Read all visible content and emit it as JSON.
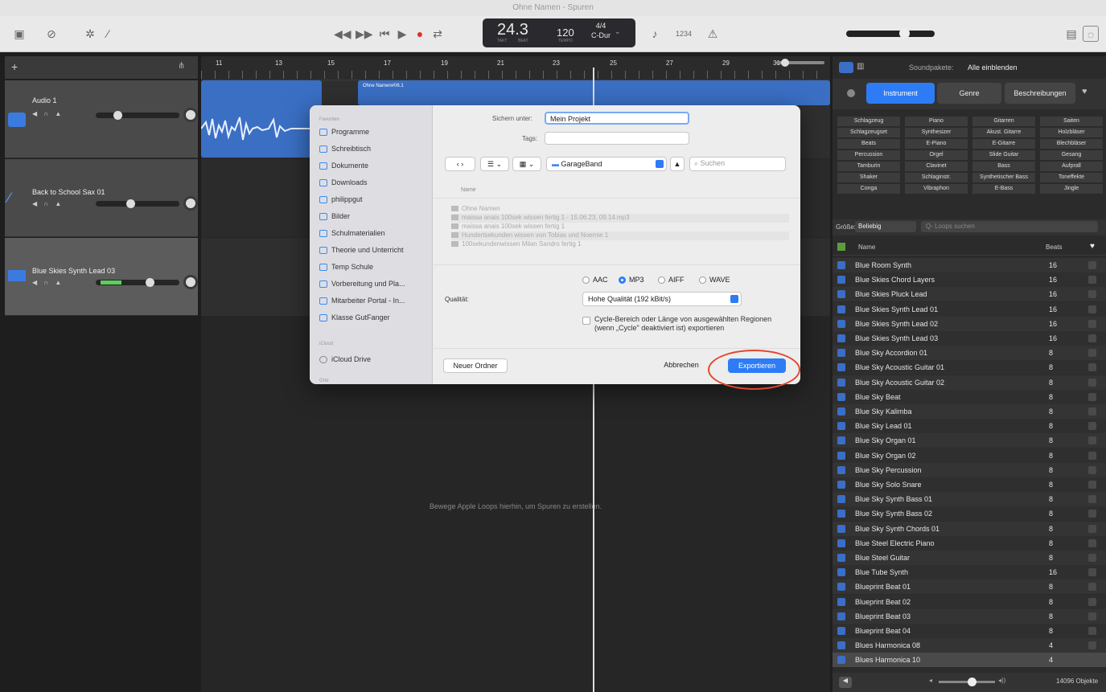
{
  "window": {
    "title": "Ohne Namen - Spuren"
  },
  "toolbar": {
    "position": "24.3",
    "position_sub1": "TAKT",
    "position_sub2": "BEAT",
    "tempo": "120",
    "tempo_sub": "TEMPO",
    "signature": "4/4",
    "key": "C-Dur",
    "count_in": "1234"
  },
  "tracks": [
    {
      "name": "Audio 1",
      "color": "#3b7be0"
    },
    {
      "name": "Back to School Sax 01",
      "color": "#3b7be0"
    },
    {
      "name": "Blue Skies Synth Lead 03",
      "color": "#3b7be0"
    }
  ],
  "ruler": {
    "ticks": [
      "11",
      "13",
      "15",
      "17",
      "19",
      "21",
      "23",
      "25",
      "27",
      "29",
      "31"
    ]
  },
  "arrange": {
    "region_label": "Ohne Namen#06.1",
    "hint": "Bewege Apple Loops hierhin, um Spuren zu erstellen."
  },
  "browser": {
    "soundpacks_label": "Soundpakete:",
    "soundpacks_value": "Alle einblenden",
    "tabs": [
      "Instrument",
      "Genre",
      "Beschreibungen"
    ],
    "chips": [
      [
        "Schlagzeug",
        "Piano",
        "Gitarren",
        "Saiten"
      ],
      [
        "Schlagzeugset",
        "Synthesizer",
        "Akust. Gitarre",
        "Holzbläser"
      ],
      [
        "Beats",
        "E-Piano",
        "E-Gitarre",
        "Blechbläser"
      ],
      [
        "Percussion",
        "Orgel",
        "Slide Guitar",
        "Gesang"
      ],
      [
        "Tamburin",
        "Clavinet",
        "Bass",
        "Aufprall"
      ],
      [
        "Shaker",
        "Schlaginstr.",
        "Synthetischer Bass",
        "Toneffekte"
      ],
      [
        "Conga",
        "Vibraphon",
        "E-Bass",
        "Jingle"
      ]
    ],
    "size_label": "Größe:",
    "size_value": "Beliebig",
    "search_placeholder": "Q- Loops suchen",
    "col_name": "Name",
    "col_beats": "Beats",
    "loops": [
      {
        "name": "Blue Room Synth",
        "beats": "16"
      },
      {
        "name": "Blue Skies Chord Layers",
        "beats": "16"
      },
      {
        "name": "Blue Skies Pluck Lead",
        "beats": "16"
      },
      {
        "name": "Blue Skies Synth Lead 01",
        "beats": "16"
      },
      {
        "name": "Blue Skies Synth Lead 02",
        "beats": "16"
      },
      {
        "name": "Blue Skies Synth Lead 03",
        "beats": "16"
      },
      {
        "name": "Blue Sky Accordion 01",
        "beats": "8"
      },
      {
        "name": "Blue Sky Acoustic Guitar 01",
        "beats": "8"
      },
      {
        "name": "Blue Sky Acoustic Guitar 02",
        "beats": "8"
      },
      {
        "name": "Blue Sky Beat",
        "beats": "8"
      },
      {
        "name": "Blue Sky Kalimba",
        "beats": "8"
      },
      {
        "name": "Blue Sky Lead 01",
        "beats": "8"
      },
      {
        "name": "Blue Sky Organ 01",
        "beats": "8"
      },
      {
        "name": "Blue Sky Organ 02",
        "beats": "8"
      },
      {
        "name": "Blue Sky Percussion",
        "beats": "8"
      },
      {
        "name": "Blue Sky Solo Snare",
        "beats": "8"
      },
      {
        "name": "Blue Sky Synth Bass 01",
        "beats": "8"
      },
      {
        "name": "Blue Sky Synth Bass 02",
        "beats": "8"
      },
      {
        "name": "Blue Sky Synth Chords 01",
        "beats": "8"
      },
      {
        "name": "Blue Steel Electric Piano",
        "beats": "8"
      },
      {
        "name": "Blue Steel Guitar",
        "beats": "8"
      },
      {
        "name": "Blue Tube Synth",
        "beats": "16"
      },
      {
        "name": "Blueprint Beat 01",
        "beats": "8"
      },
      {
        "name": "Blueprint Beat 02",
        "beats": "8"
      },
      {
        "name": "Blueprint Beat 03",
        "beats": "8"
      },
      {
        "name": "Blueprint Beat 04",
        "beats": "8"
      },
      {
        "name": "Blues Harmonica 08",
        "beats": "4"
      },
      {
        "name": "Blues Harmonica 10",
        "beats": "4"
      }
    ],
    "count": "14096 Objekte"
  },
  "dialog": {
    "sidebar_favorites": "Favoriten",
    "sidebar_items": [
      "Programme",
      "Schreibtisch",
      "Dokumente",
      "Downloads",
      "philippgut",
      "Bilder",
      "Schulmaterialien",
      "Theorie und Unterricht",
      "Temp Schule",
      "Vorbereitung und Pla...",
      "Mitarbeiter Portal - In...",
      "Klasse GutFanger"
    ],
    "sidebar_icloud": "iCloud",
    "icloud_drive": "iCloud Drive",
    "sidebar_orte": "Orte",
    "save_as_label": "Sichern unter:",
    "save_as_value": "Mein Projekt",
    "tags_label": "Tags:",
    "location": "GarageBand",
    "search_placeholder": "Suchen",
    "col_name": "Name",
    "files": [
      "Ohne Namen",
      "maissa anais 100sek wissen fertig 1 - 15.06.23, 09.14.mp3",
      "maissa anais 100sek wissen fertig 1",
      "Hundertsekunden wissen von Tobias und Noemie 1",
      "100sekundenwissen Milan Sandro fertig 1"
    ],
    "formats": [
      "AAC",
      "MP3",
      "AIFF",
      "WAVE"
    ],
    "quality_label": "Qualität:",
    "quality_value": "Hohe Qualität (192 kBit/s)",
    "cycle_text": "Cycle-Bereich oder Länge von ausgewählten Regionen (wenn „Cycle\" deaktiviert ist) exportieren",
    "new_folder": "Neuer Ordner",
    "cancel": "Abbrechen",
    "export": "Exportieren"
  }
}
